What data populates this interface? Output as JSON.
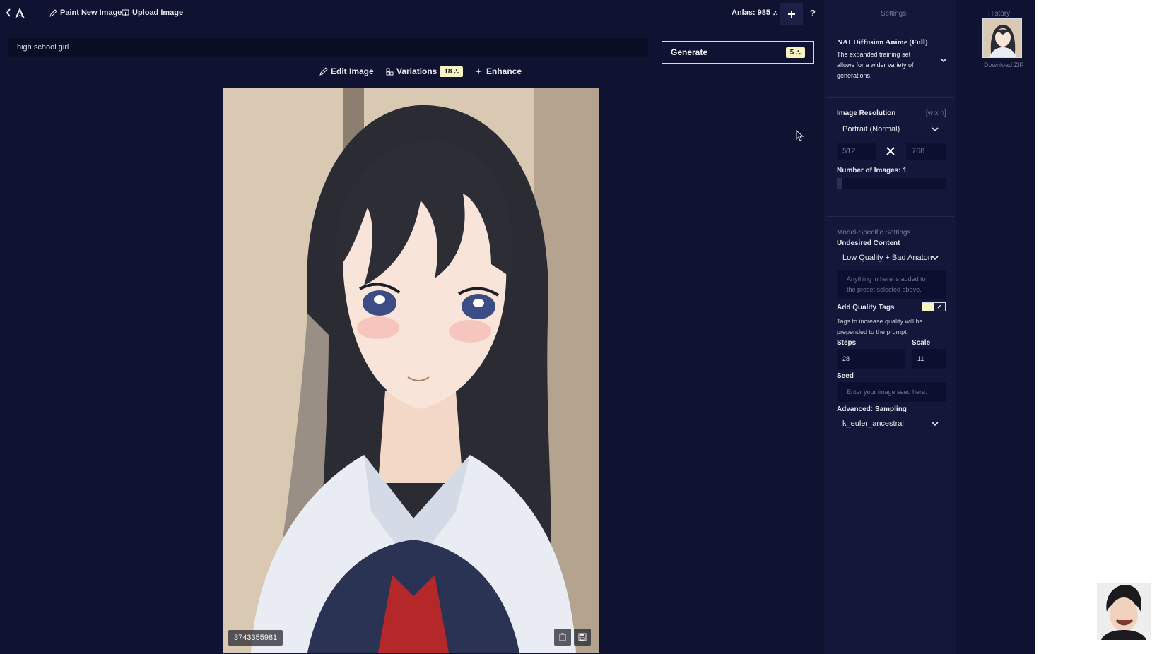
{
  "topbar": {
    "back_icon": "chevron-left-icon",
    "logo_icon": "novelai-logo-icon",
    "paint_label": "Paint New Image",
    "upload_label": "Upload Image",
    "anlas": "Anlas: 985",
    "add_icon": "plus-icon",
    "help": "?"
  },
  "prompt": {
    "value": "high school girl"
  },
  "generate": {
    "label": "Generate",
    "cost": "5"
  },
  "actions": {
    "edit_label": "Edit Image",
    "variations_label": "Variations",
    "variations_cost": "18",
    "enhance_label": "Enhance"
  },
  "image": {
    "seed": "3743355981"
  },
  "settings": {
    "header": "Settings",
    "model_name": "NAI Diffusion Anime (Full)",
    "model_desc": "The expanded training set allows for a wider variety of generations.",
    "resolution_label": "Image Resolution",
    "resolution_hint": "[w x h]",
    "resolution_preset": "Portrait (Normal)",
    "width": "512",
    "height": "768",
    "num_images_label": "Number of Images:",
    "num_images_value": "1",
    "num_images_fraction": 0.05,
    "model_settings_label": "Model-Specific Settings",
    "undesired_label": "Undesired Content",
    "undesired_preset": "Low Quality + Bad Anatomy",
    "undesired_placeholder": "Anything in here is added to the preset selected above.",
    "quality_tags_label": "Add Quality Tags",
    "quality_tags_on": true,
    "quality_tags_desc": "Tags to increase quality will be prepended to the prompt.",
    "steps_label": "Steps",
    "steps_value": "28",
    "scale_label": "Scale",
    "scale_value": "11",
    "seed_label": "Seed",
    "seed_placeholder": "Enter your image seed here.",
    "sampling_label": "Advanced: Sampling",
    "sampling_value": "k_euler_ancestral"
  },
  "history": {
    "header": "History",
    "download": "Download ZIP"
  },
  "colors": {
    "background": "#0f1230",
    "panel": "#131739",
    "accent": "#f5f3c2"
  }
}
